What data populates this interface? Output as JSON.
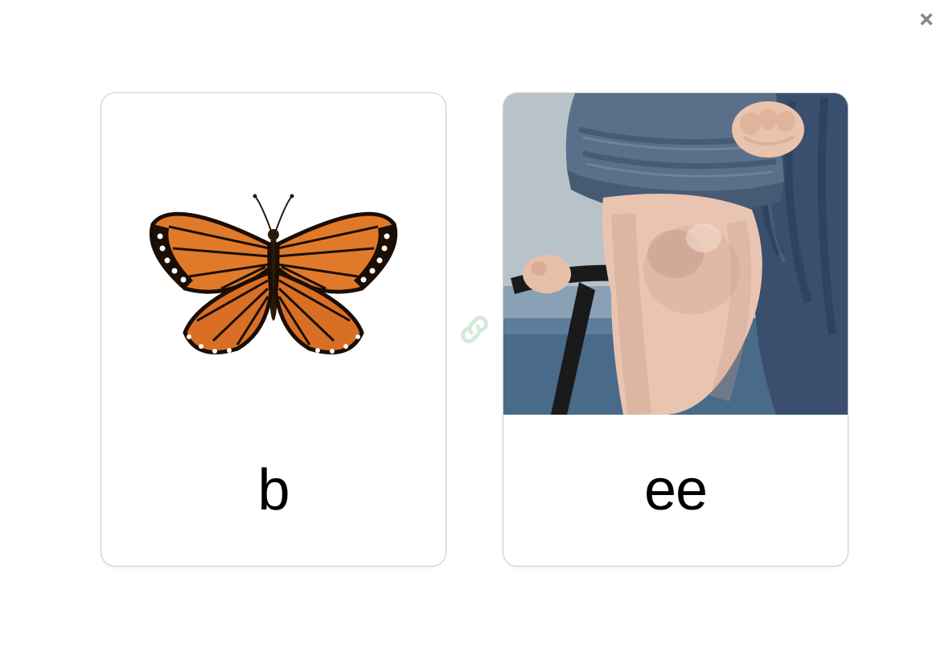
{
  "close_label": "Close",
  "link_icon_name": "link-icon",
  "cards": [
    {
      "label": "b",
      "image": "butterfly"
    },
    {
      "label": "ee",
      "image": "knee"
    }
  ]
}
